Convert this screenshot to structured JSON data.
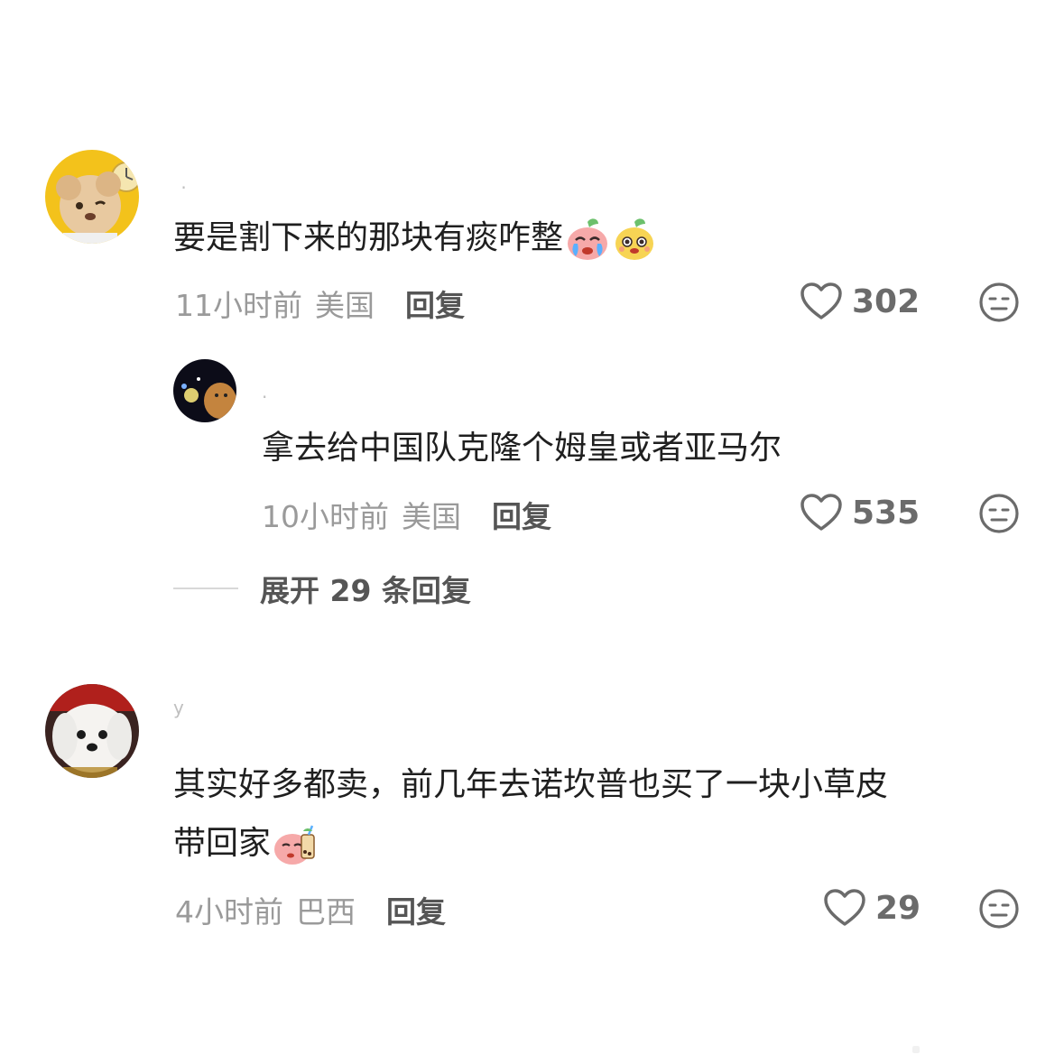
{
  "comments": [
    {
      "username": " ·",
      "text": "要是割下来的那块有痰咋整",
      "emojis": [
        "crying-face-emoji",
        "yellow-face-emoji"
      ],
      "time": "11小时前",
      "location": "美国",
      "reply_label": "回复",
      "likes": "302"
    },
    {
      "username": "·",
      "text": "拿去给中国队克隆个姆皇或者亚马尔",
      "time": "10小时前",
      "location": "美国",
      "reply_label": "回复",
      "likes": "535"
    },
    {
      "username": "y",
      "text_line1": "其实好多都卖，前几年去诺坎普也买了一块小草皮",
      "text_line2": "带回家",
      "emojis": [
        "bubble-tea-face-emoji"
      ],
      "time": "4小时前",
      "location": "巴西",
      "reply_label": "回复",
      "likes": "29"
    }
  ],
  "expand_replies": "展开 29 条回复",
  "colors": {
    "text": "#1f1f1f",
    "meta": "#9a9a9a",
    "icon": "#6b6b6b"
  }
}
